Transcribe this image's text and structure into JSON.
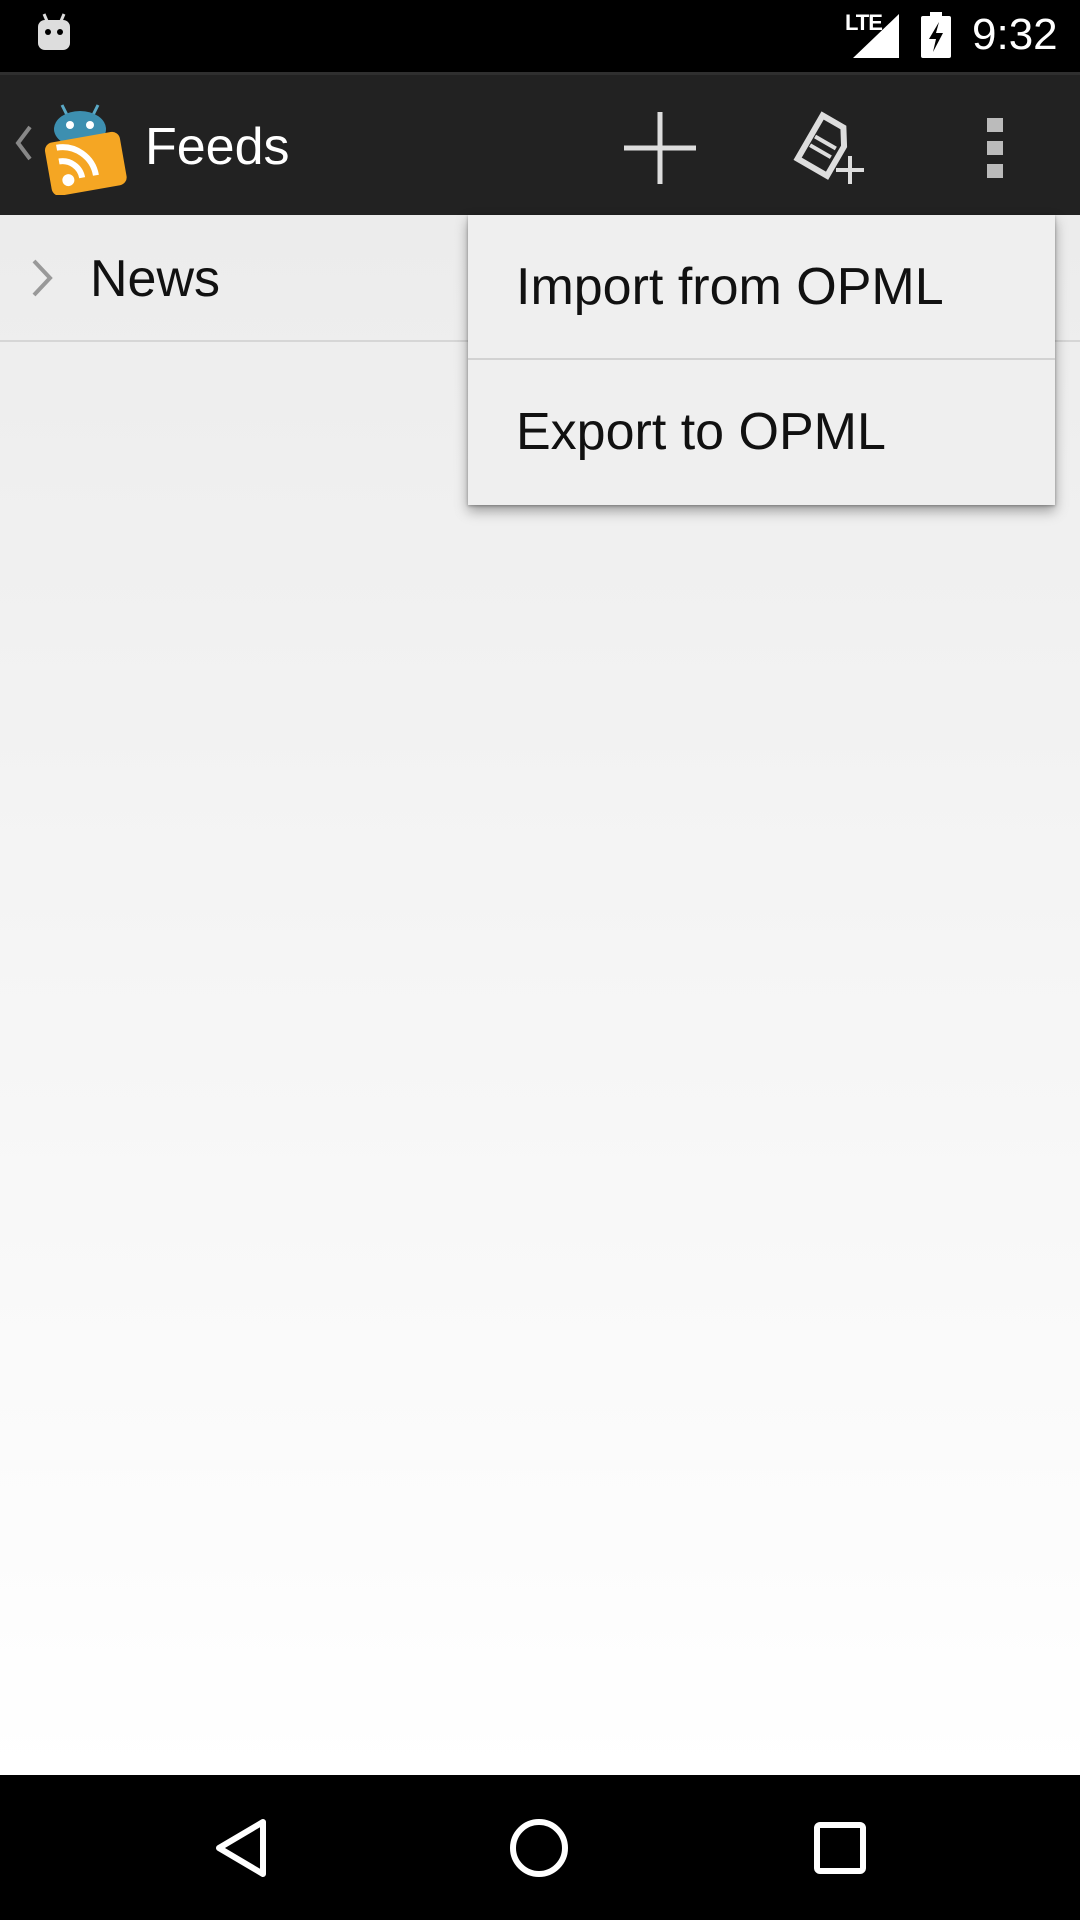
{
  "status_bar": {
    "network": "LTE",
    "time": "9:32",
    "icons": [
      "android-notification-icon",
      "signal-icon",
      "battery-charging-icon"
    ]
  },
  "action_bar": {
    "title": "Feeds",
    "actions": [
      {
        "icon": "add-icon"
      },
      {
        "icon": "add-tag-icon"
      },
      {
        "icon": "overflow-menu-icon"
      }
    ]
  },
  "list": {
    "items": [
      {
        "label": "News",
        "icon": "chevron-right-icon"
      }
    ]
  },
  "overflow_menu": {
    "items": [
      {
        "label": "Import from OPML"
      },
      {
        "label": "Export to OPML"
      }
    ]
  },
  "navigation_bar": {
    "buttons": [
      "back-icon",
      "home-icon",
      "recents-icon"
    ]
  },
  "colors": {
    "action_bar_bg": "#222222",
    "menu_bg": "#efefef",
    "rss_orange": "#f5a623"
  }
}
